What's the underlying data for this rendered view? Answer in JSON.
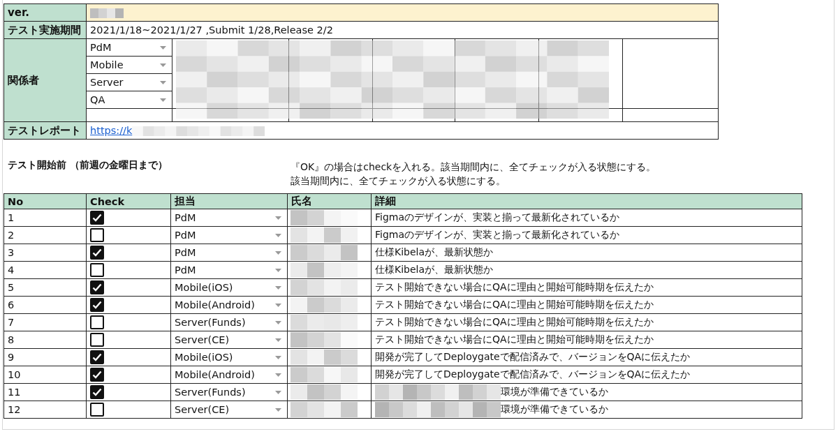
{
  "info": {
    "version_label": "ver.",
    "period_label": "テスト実施期間",
    "period": "2021/1/18~2021/1/27 ,Submit 1/28,Release 2/2",
    "stakeholders_label": "関係者",
    "roles": [
      {
        "label": "PdM"
      },
      {
        "label": "Mobile"
      },
      {
        "label": "Server"
      },
      {
        "label": "QA"
      }
    ],
    "report_label": "テストレポート",
    "report_link": "https://k"
  },
  "section": {
    "title": "テスト開始前 （前週の金曜日まで）",
    "notes": [
      "『OK』の場合はcheckを入れる。該当期間内に、全てチェックが入る状態にする。",
      "該当期間内に、全てチェックが入る状態にする。"
    ]
  },
  "table": {
    "columns": [
      "No",
      "Check",
      "担当",
      "氏名",
      "詳細"
    ],
    "rows": [
      {
        "no": "1",
        "checked": true,
        "role": "PdM",
        "detail": "Figmaのデザインが、実装と揃って最新化されているか",
        "detail_redacted": false
      },
      {
        "no": "2",
        "checked": false,
        "role": "PdM",
        "detail": "Figmaのデザインが、実装と揃って最新化されているか",
        "detail_redacted": false
      },
      {
        "no": "3",
        "checked": true,
        "role": "PdM",
        "detail": "仕様Kibelaが、最新状態か",
        "detail_redacted": false
      },
      {
        "no": "4",
        "checked": false,
        "role": "PdM",
        "detail": "仕様Kibelaが、最新状態か",
        "detail_redacted": false
      },
      {
        "no": "5",
        "checked": true,
        "role": "Mobile(iOS)",
        "detail": "テスト開始できない場合にQAに理由と開始可能時期を伝えたか",
        "detail_redacted": false
      },
      {
        "no": "6",
        "checked": true,
        "role": "Mobile(Android)",
        "detail": "テスト開始できない場合にQAに理由と開始可能時期を伝えたか",
        "detail_redacted": false
      },
      {
        "no": "7",
        "checked": false,
        "role": "Server(Funds)",
        "detail": "テスト開始できない場合にQAに理由と開始可能時期を伝えたか",
        "detail_redacted": false
      },
      {
        "no": "8",
        "checked": false,
        "role": "Server(CE)",
        "detail": "テスト開始できない場合にQAに理由と開始可能時期を伝えたか",
        "detail_redacted": false
      },
      {
        "no": "9",
        "checked": true,
        "role": "Mobile(iOS)",
        "detail": "開発が完了してDeploygateで配信済みで、バージョンをQAに伝えたか",
        "detail_redacted": false
      },
      {
        "no": "10",
        "checked": true,
        "role": "Mobile(Android)",
        "detail": "開発が完了してDeploygateで配信済みで、バージョンをQAに伝えたか",
        "detail_redacted": false
      },
      {
        "no": "11",
        "checked": true,
        "role": "Server(Funds)",
        "detail": "環境が準備できているか",
        "detail_redacted": true
      },
      {
        "no": "12",
        "checked": false,
        "role": "Server(CE)",
        "detail": "環境が準備できているか",
        "detail_redacted": true
      }
    ]
  }
}
